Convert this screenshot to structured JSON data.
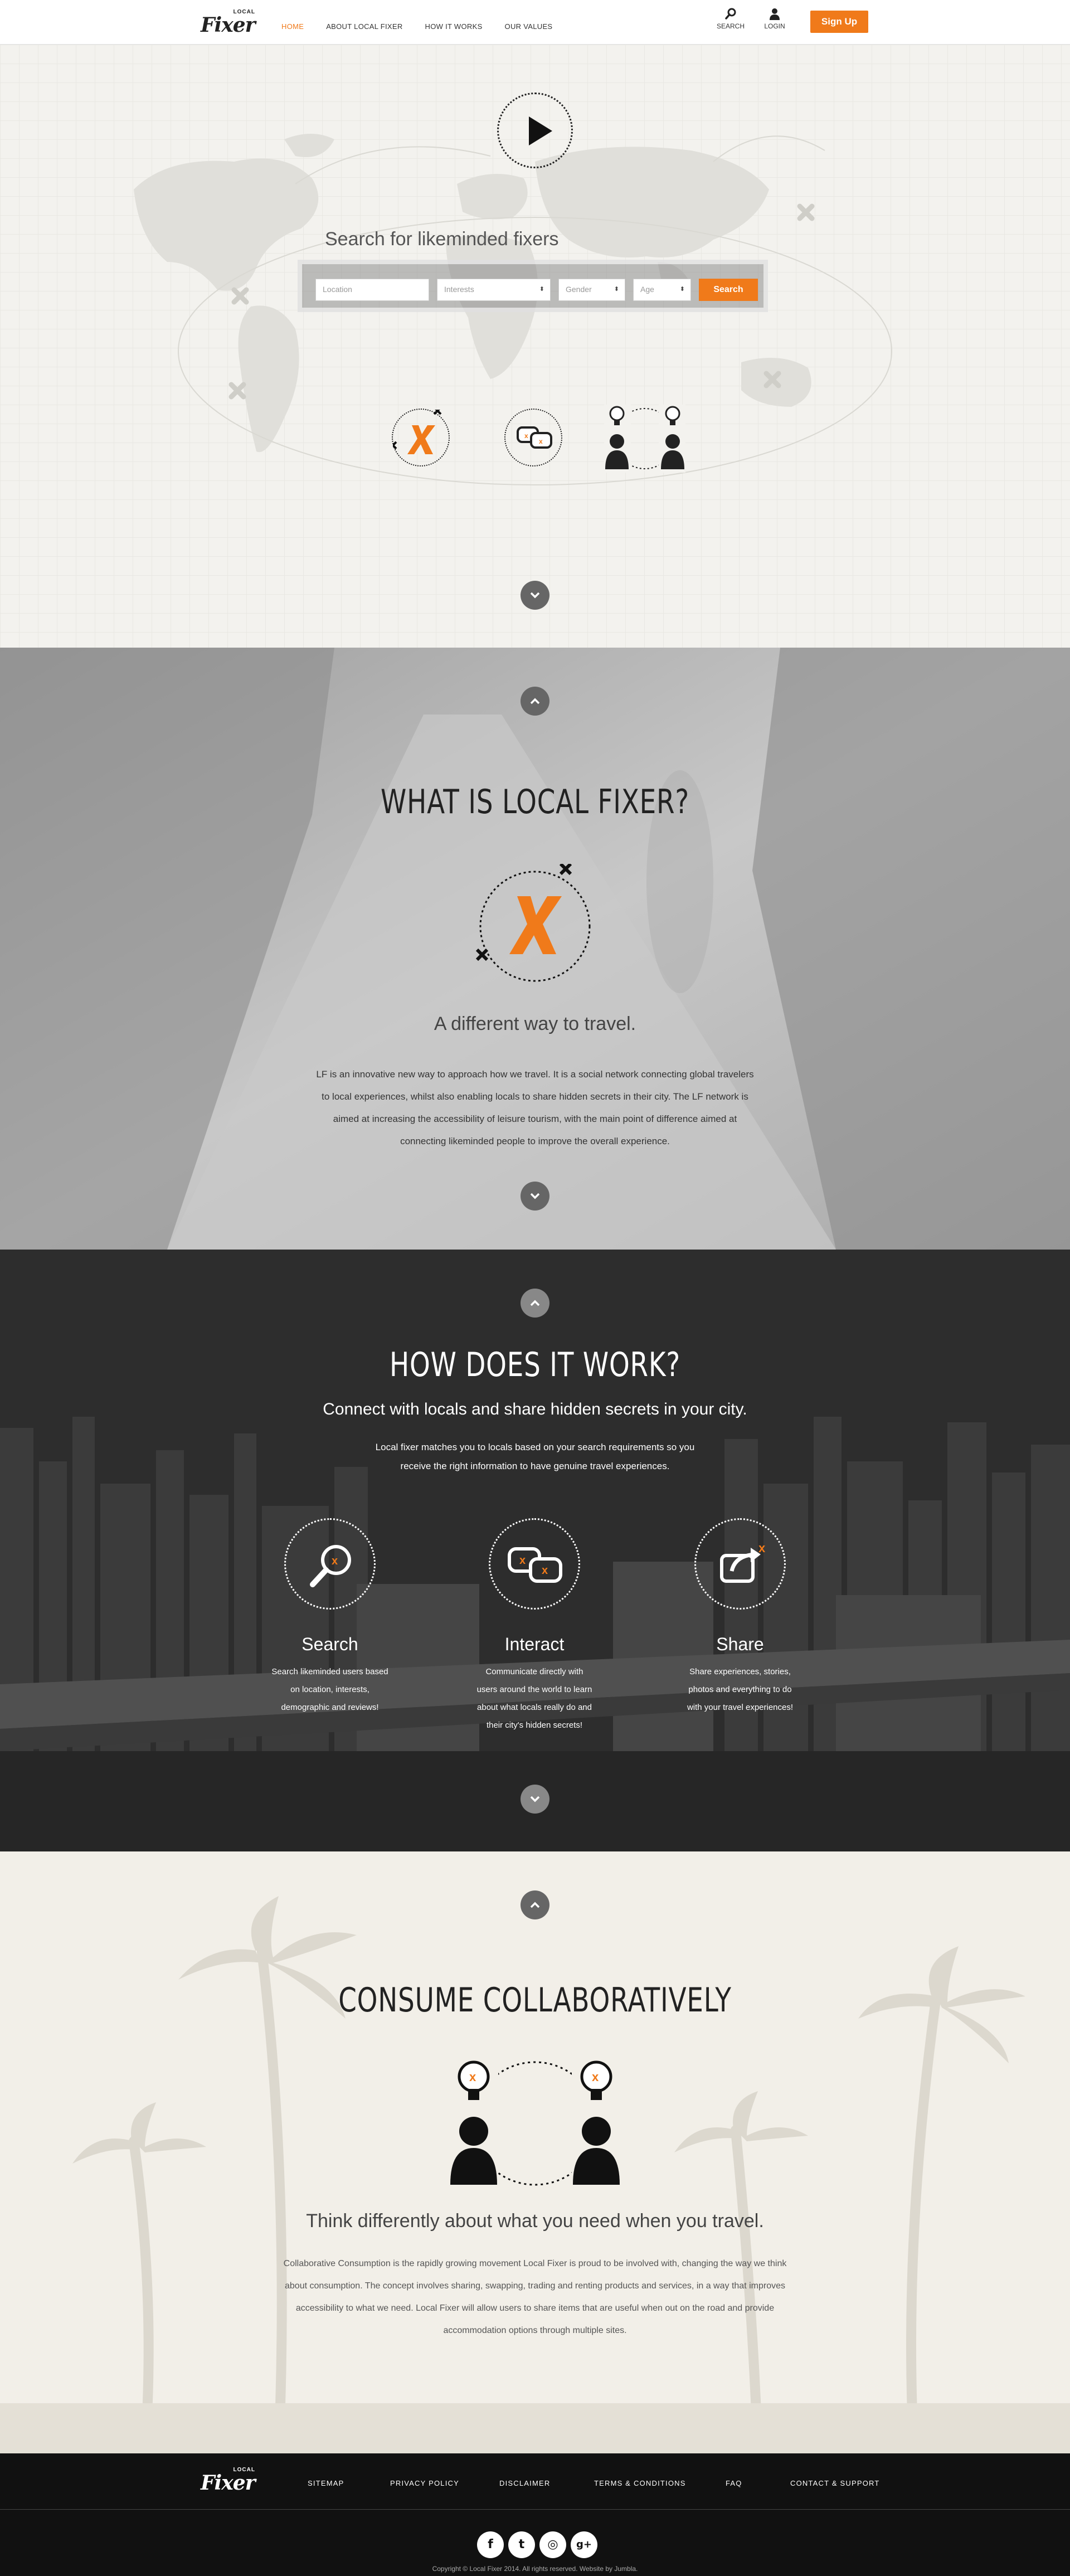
{
  "header": {
    "logo_small": "LOCAL",
    "logo_big": "Fixer",
    "nav": [
      {
        "label": "HOME",
        "active": true
      },
      {
        "label": "ABOUT LOCAL FIXER",
        "active": false
      },
      {
        "label": "HOW IT WORKS",
        "active": false
      },
      {
        "label": "OUR VALUES",
        "active": false
      }
    ],
    "search_label": "SEARCH",
    "login_label": "LOGIN",
    "signup_label": "Sign Up"
  },
  "hero": {
    "search_title": "Search for likeminded fixers",
    "location_placeholder": "Location",
    "interests_value": "Interests",
    "gender_value": "Gender",
    "age_value": "Age",
    "search_button": "Search"
  },
  "what": {
    "title": "WHAT IS LOCAL FIXER?",
    "subtitle": "A different way to travel.",
    "body_lines": [
      "LF is an innovative new way to approach how we travel.  It is a social network connecting global travelers",
      "to local experiences, whilst also enabling locals to share hidden secrets in their city. The LF network is",
      "aimed at increasing the accessibility of leisure tourism, with the main point of difference aimed at",
      "connecting likeminded people to improve the overall experience."
    ]
  },
  "how": {
    "title": "HOW DOES IT WORK?",
    "subtitle": "Connect with locals and share hidden secrets in your city.",
    "intro_lines": [
      "Local fixer matches you to locals based on your search requirements so you",
      "receive the right information to have genuine travel experiences."
    ],
    "features": [
      {
        "title": "Search",
        "lines": [
          "Search likeminded users based",
          "on location, interests,",
          "demographic and reviews!"
        ]
      },
      {
        "title": "Interact",
        "lines": [
          "Communicate directly with",
          "users around the world to learn",
          "about what locals really do and",
          "their city's hidden secrets!"
        ]
      },
      {
        "title": "Share",
        "lines": [
          "Share experiences, stories,",
          "photos and everything to do",
          "with your travel experiences!"
        ]
      }
    ]
  },
  "consume": {
    "title": "CONSUME COLLABORATIVELY",
    "subtitle": "Think differently about what you need when you travel.",
    "body_lines": [
      "Collaborative Consumption is the rapidly growing movement Local Fixer is proud to be involved with, changing the way we think",
      "about consumption. The concept involves sharing, swapping, trading and renting products and services, in a way that improves",
      "accessibility to what we need. Local Fixer will allow users to share items that are useful when out on the road and provide",
      "accommodation options through multiple sites."
    ]
  },
  "footer": {
    "logo_small": "LOCAL",
    "logo_big": "Fixer",
    "links": [
      "SITEMAP",
      "PRIVACY POLICY",
      "DISCLAIMER",
      "TERMS & CONDITIONS",
      "FAQ",
      "CONTACT & SUPPORT"
    ],
    "social": [
      {
        "icon": "facebook-icon",
        "glyph": "f"
      },
      {
        "icon": "twitter-icon",
        "glyph": "t"
      },
      {
        "icon": "instagram-icon",
        "glyph": "◎"
      },
      {
        "icon": "googleplus-icon",
        "glyph": "g+"
      }
    ],
    "copyright": "Copyright © Local Fixer 2014. All rights reserved. Website by Jumbla."
  },
  "colors": {
    "accent": "#f07a1a",
    "dark": "#111111"
  }
}
